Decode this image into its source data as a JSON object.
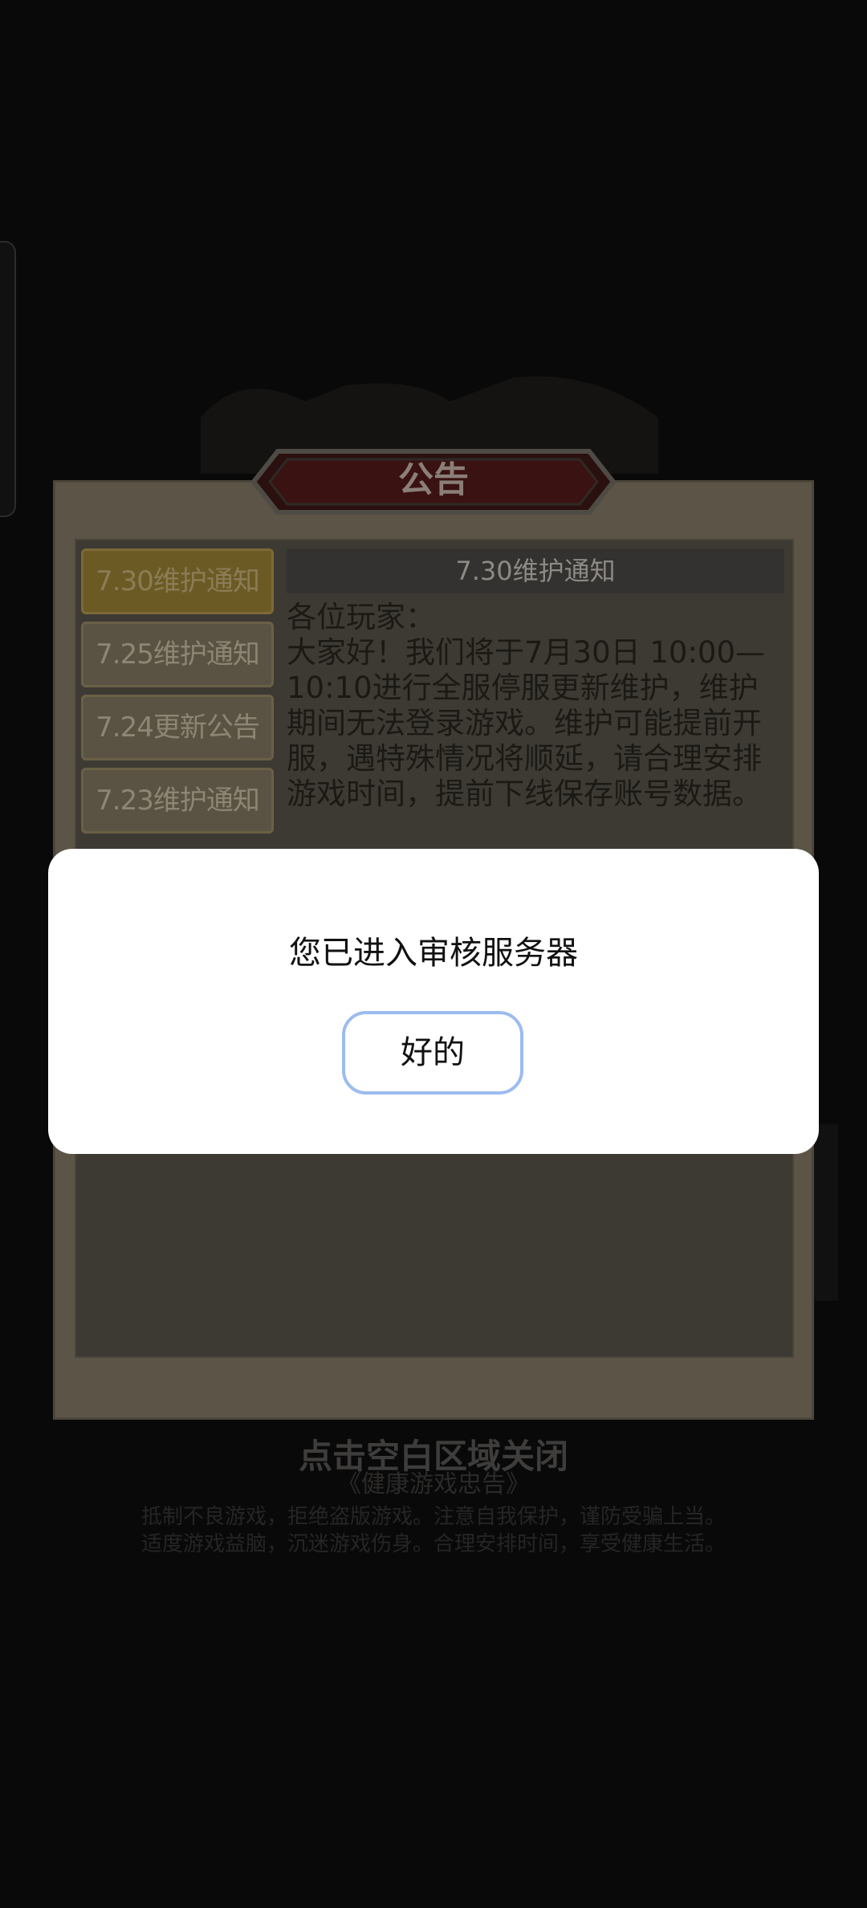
{
  "announcement": {
    "banner_title": "公告",
    "tabs": [
      "7.30维护通知",
      "7.25维护通知",
      "7.24更新公告",
      "7.23维护通知"
    ],
    "active_tab_index": 0,
    "content_title": "7.30维护通知",
    "content_body": "各位玩家：\n大家好！我们将于7月30日 10:00—10:10进行全服停服更新维护，维护期间无法登录游戏。维护可能提前开服，遇特殊情况将顺延，请合理安排游戏时间，提前下线保存账号数据。"
  },
  "close_hint": "点击空白区域关闭",
  "footer": {
    "title": "《健康游戏忠告》",
    "line1": "抵制不良游戏，拒绝盗版游戏。注意自我保护，谨防受骗上当。",
    "line2": "适度游戏益脑，沉迷游戏伤身。合理安排时间，享受健康生活。"
  },
  "dialog": {
    "message": "您已进入审核服务器",
    "ok_label": "好的"
  },
  "colors": {
    "background": "#0a0909",
    "modal": "#ffffff",
    "ok_border": "#9cbcf0",
    "active_tab": "#6c5a24"
  }
}
